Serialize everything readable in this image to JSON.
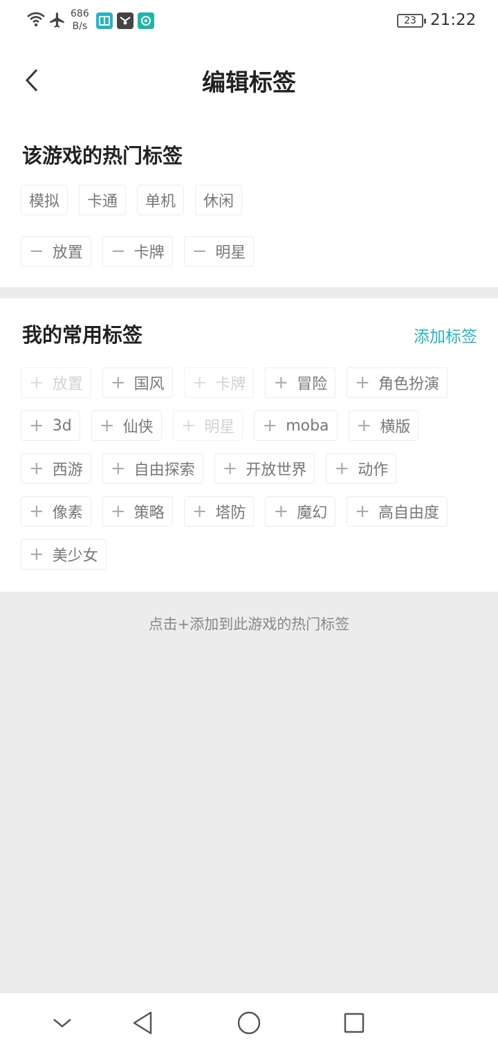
{
  "status_bar": {
    "speed_value": "686",
    "speed_unit": "B/s",
    "battery": "23",
    "time": "21:22"
  },
  "header": {
    "title": "编辑标签"
  },
  "hot_section": {
    "title": "该游戏的热门标签",
    "tags": [
      {
        "label": "模拟",
        "removable": false
      },
      {
        "label": "卡通",
        "removable": false
      },
      {
        "label": "单机",
        "removable": false
      },
      {
        "label": "休闲",
        "removable": false
      },
      {
        "label": "放置",
        "removable": true,
        "symbol": "−"
      },
      {
        "label": "卡牌",
        "removable": true,
        "symbol": "−"
      },
      {
        "label": "明星",
        "removable": true,
        "symbol": "−"
      }
    ]
  },
  "my_section": {
    "title": "我的常用标签",
    "add_link": "添加标签",
    "tags": [
      {
        "label": "放置",
        "disabled": true
      },
      {
        "label": "国风",
        "disabled": false
      },
      {
        "label": "卡牌",
        "disabled": true
      },
      {
        "label": "冒险",
        "disabled": false
      },
      {
        "label": "角色扮演",
        "disabled": false
      },
      {
        "label": "3d",
        "disabled": false
      },
      {
        "label": "仙侠",
        "disabled": false
      },
      {
        "label": "明星",
        "disabled": true
      },
      {
        "label": "moba",
        "disabled": false
      },
      {
        "label": "横版",
        "disabled": false
      },
      {
        "label": "西游",
        "disabled": false
      },
      {
        "label": "自由探索",
        "disabled": false
      },
      {
        "label": "开放世界",
        "disabled": false
      },
      {
        "label": "动作",
        "disabled": false
      },
      {
        "label": "像素",
        "disabled": false
      },
      {
        "label": "策略",
        "disabled": false
      },
      {
        "label": "塔防",
        "disabled": false
      },
      {
        "label": "魔幻",
        "disabled": false
      },
      {
        "label": "高自由度",
        "disabled": false
      },
      {
        "label": "美少女",
        "disabled": false
      }
    ],
    "add_symbol": "+"
  },
  "hint": "点击+添加到此游戏的热门标签",
  "colors": {
    "accent": "#27b3c0",
    "background": "#ececec"
  }
}
